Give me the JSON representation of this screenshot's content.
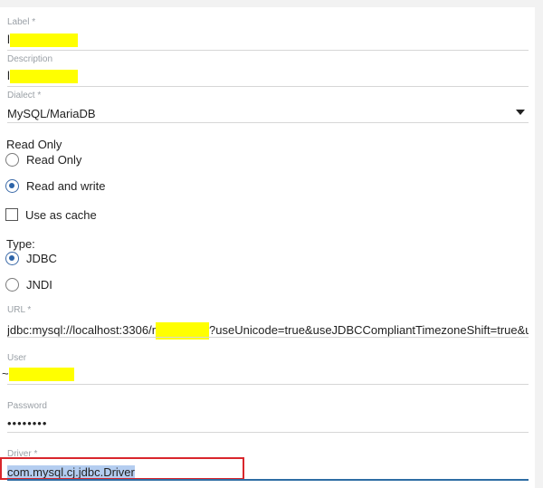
{
  "form": {
    "label": {
      "label": "Label *",
      "value": "l"
    },
    "description": {
      "label": "Description",
      "value": "l"
    },
    "dialect": {
      "label": "Dialect *",
      "value": "MySQL/MariaDB"
    },
    "read_only": {
      "title": "Read Only",
      "options": [
        {
          "label": "Read Only",
          "selected": false
        },
        {
          "label": "Read and write",
          "selected": true
        }
      ]
    },
    "cache": {
      "label": "Use as cache",
      "checked": false
    },
    "type": {
      "title": "Type:",
      "options": [
        {
          "label": "JDBC",
          "selected": true
        },
        {
          "label": "JNDI",
          "selected": false
        }
      ]
    },
    "url": {
      "label": "URL *",
      "value_prefix": "jdbc:mysql://localhost:3306/",
      "value_redacted_first_char": "r",
      "value_suffix": "?useUnicode=true&useJDBCCompliantTimezoneShift=true&useL"
    },
    "user": {
      "label": "User",
      "value": "~"
    },
    "password": {
      "label": "Password",
      "value": "••••••••"
    },
    "driver": {
      "label": "Driver *",
      "value": "com.mysql.cj.jdbc.Driver"
    }
  },
  "colors": {
    "redaction": "#ffff00",
    "accent": "#2c63a8",
    "annotation_border": "#d9262c",
    "selection": "#b4cdf0"
  }
}
